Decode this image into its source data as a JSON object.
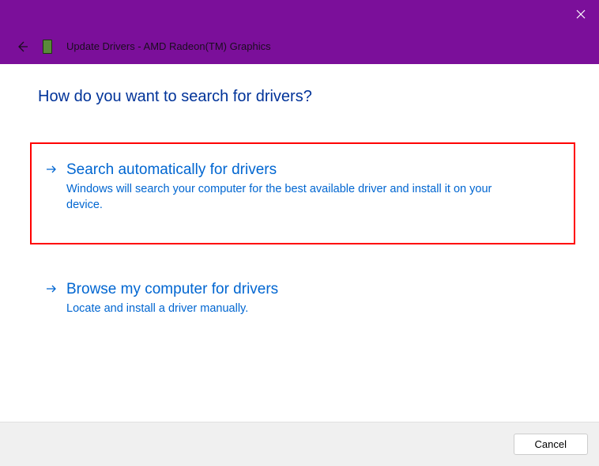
{
  "titlebar": {
    "close_icon": "close"
  },
  "header": {
    "title": "Update Drivers - AMD Radeon(TM) Graphics"
  },
  "content": {
    "heading": "How do you want to search for drivers?",
    "options": [
      {
        "title": "Search automatically for drivers",
        "desc": "Windows will search your computer for the best available driver and install it on your device."
      },
      {
        "title": "Browse my computer for drivers",
        "desc": "Locate and install a driver manually."
      }
    ]
  },
  "footer": {
    "cancel_label": "Cancel"
  }
}
